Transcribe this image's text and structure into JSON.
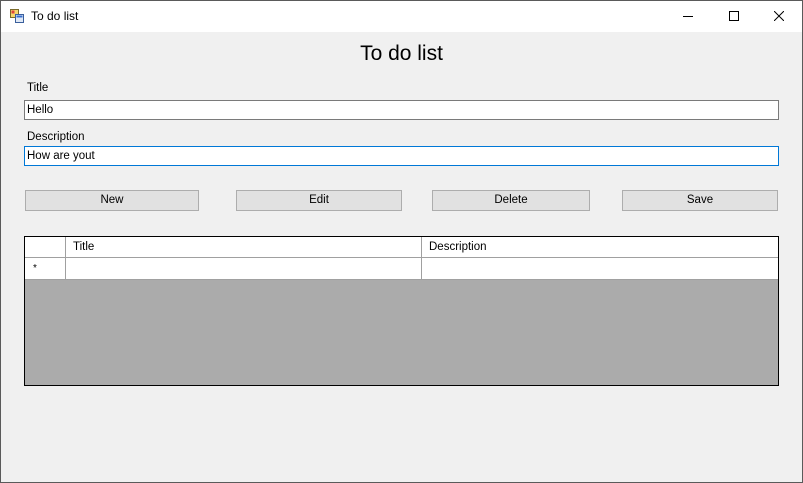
{
  "window": {
    "title": "To do list",
    "icon": "form-app-icon"
  },
  "form": {
    "heading": "To do list",
    "title_label": "Title",
    "title_value": "Hello",
    "description_label": "Description",
    "description_value": "How are yout"
  },
  "buttons": {
    "new": "New",
    "edit": "Edit",
    "delete": "Delete",
    "save": "Save"
  },
  "grid": {
    "columns": [
      "Title",
      "Description"
    ],
    "new_row_marker": "*",
    "rows": [
      {
        "title": "",
        "description": ""
      }
    ]
  },
  "colors": {
    "focus_border": "#0078d7",
    "grid_background": "#ababab",
    "form_background": "#f0f0f0"
  }
}
